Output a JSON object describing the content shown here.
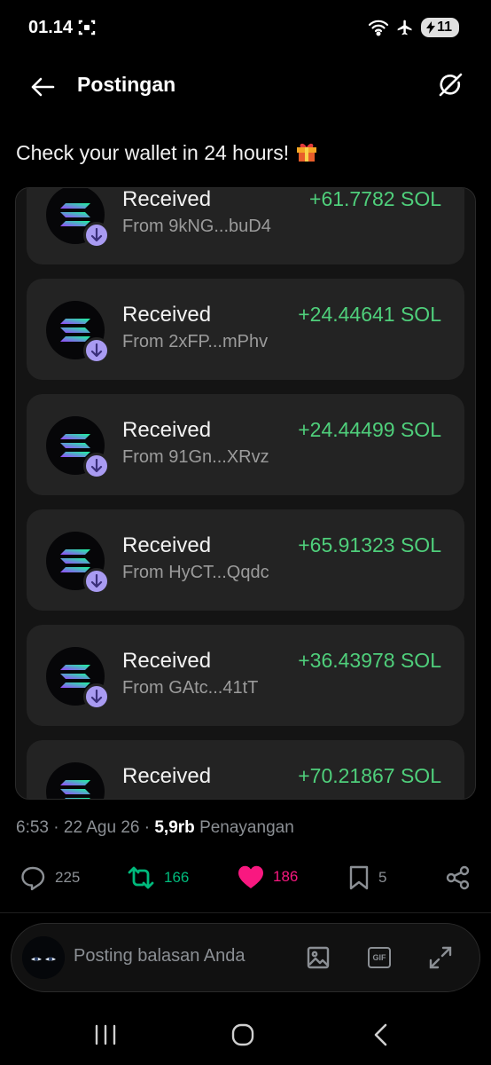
{
  "status_bar": {
    "time": "01.14",
    "battery": "11"
  },
  "header": {
    "title": "Postingan"
  },
  "post": {
    "text": "Check your wallet in 24 hours!"
  },
  "transactions": [
    {
      "title": "Received",
      "from": "From 9kNG...buD4",
      "amount": "+61.7782 SOL"
    },
    {
      "title": "Received",
      "from": "From 2xFP...mPhv",
      "amount": "+24.44641 SOL"
    },
    {
      "title": "Received",
      "from": "From 91Gn...XRvz",
      "amount": "+24.44499 SOL"
    },
    {
      "title": "Received",
      "from": "From HyCT...Qqdc",
      "amount": "+65.91323 SOL"
    },
    {
      "title": "Received",
      "from": "From GAtc...41tT",
      "amount": "+36.43978 SOL"
    },
    {
      "title": "Received",
      "from": "",
      "amount": "+70.21867 SOL"
    }
  ],
  "meta": {
    "time": "6:53",
    "date": "22 Agu 26",
    "views_count": "5,9rb",
    "views_label": "Penayangan"
  },
  "actions": {
    "replies": "225",
    "reposts": "166",
    "likes": "186",
    "bookmarks": "5"
  },
  "reply_bar": {
    "placeholder": "Posting balasan Anda",
    "gif_label": "GIF"
  },
  "colors": {
    "accent_green": "#4fcf7b",
    "repost_green": "#00ba7c",
    "like_pink": "#f91880",
    "badge_purple": "#a99bf2"
  },
  "icons": [
    "arrow-left-icon",
    "grok-icon",
    "gift-icon",
    "solana-icon",
    "arrow-down-icon",
    "reply-icon",
    "repost-icon",
    "heart-icon",
    "bookmark-icon",
    "share-icon",
    "image-icon",
    "gif-icon",
    "expand-icon",
    "recent-apps-icon",
    "home-icon",
    "back-icon"
  ]
}
